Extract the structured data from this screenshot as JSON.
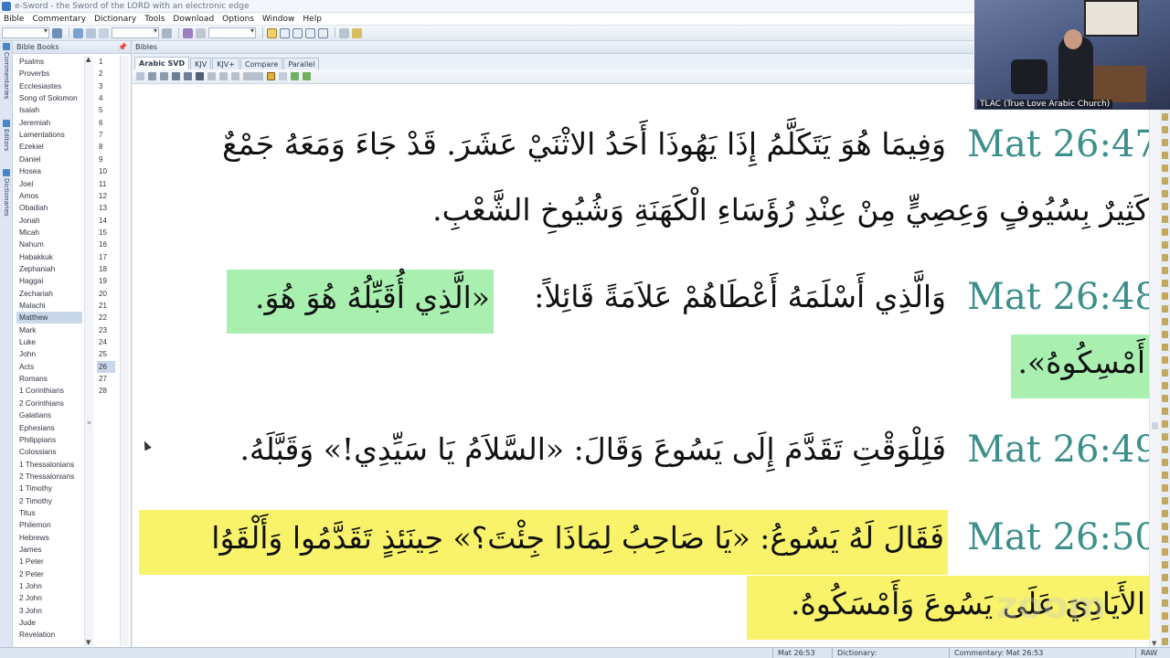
{
  "window": {
    "title": "e-Sword - the Sword of the LORD with an electronic edge"
  },
  "menu": [
    "Bible",
    "Commentary",
    "Dictionary",
    "Tools",
    "Download",
    "Options",
    "Window",
    "Help"
  ],
  "side_tabs": [
    "Commentaries",
    "Editors",
    "Dictionaries"
  ],
  "books_panel": {
    "title": "Bible Books",
    "pin": "📌",
    "books": [
      "Psalms",
      "Proverbs",
      "Ecclesiastes",
      "Song of Solomon",
      "Isaiah",
      "Jeremiah",
      "Lamentations",
      "Ezekiel",
      "Daniel",
      "Hosea",
      "Joel",
      "Amos",
      "Obadiah",
      "Jonah",
      "Micah",
      "Nahum",
      "Habakkuk",
      "Zephaniah",
      "Haggai",
      "Zechariah",
      "Malachi",
      "Matthew",
      "Mark",
      "Luke",
      "John",
      "Acts",
      "Romans",
      "1 Corinthians",
      "2 Corinthians",
      "Galatians",
      "Ephesians",
      "Philippians",
      "Colossians",
      "1 Thessalonians",
      "2 Thessalonians",
      "1 Timothy",
      "2 Timothy",
      "Titus",
      "Philemon",
      "Hebrews",
      "James",
      "1 Peter",
      "2 Peter",
      "1 John",
      "2 John",
      "3 John",
      "Jude",
      "Revelation"
    ],
    "selected_book": "Matthew",
    "chapters": [
      "1",
      "2",
      "3",
      "4",
      "5",
      "6",
      "7",
      "8",
      "9",
      "10",
      "11",
      "12",
      "13",
      "14",
      "15",
      "16",
      "17",
      "18",
      "19",
      "20",
      "21",
      "22",
      "23",
      "24",
      "25",
      "26",
      "27",
      "28"
    ],
    "selected_chapter": "26"
  },
  "bibles": {
    "title": "Bibles",
    "tabs": [
      "Arabic SVD",
      "KJV",
      "KJV+",
      "Compare",
      "Parallel"
    ],
    "active_tab": "Arabic SVD"
  },
  "verses": [
    {
      "ref": "Mat 26:47",
      "lines": [
        "وَفِيمَا هُوَ يَتَكَلَّمُ إِذَا يَهُوذَا أَحَدُ الاثْنَيْ عَشَرَ. قَدْ جَاءَ وَمَعَهُ جَمْعٌ",
        "كَثِيرٌ بِسُيُوفٍ وَعِصِيٍّ مِنْ عِنْدِ رُؤَسَاءِ الْكَهَنَةِ وَشُيُوخِ الشَّعْبِ."
      ]
    },
    {
      "ref": "Mat 26:48",
      "lines": [
        "وَالَّذِي أَسْلَمَهُ أَعْطَاهُمْ عَلاَمَةً قَائِلاً:",
        "«الَّذِي أُقَبِّلُهُ هُوَ هُوَ.",
        "أَمْسِكُوهُ»."
      ]
    },
    {
      "ref": "Mat 26:49",
      "lines": [
        "فَلِلْوَقْتِ تَقَدَّمَ إِلَى يَسُوعَ وَقَالَ: «السَّلاَمُ يَا سَيِّدِي!» وَقَبَّلَهُ."
      ]
    },
    {
      "ref": "Mat 26:50",
      "lines": [
        "فَقَالَ لَهُ يَسُوعُ: «يَا صَاحِبُ لِمَاذَا جِئْتَ؟» حِينَئِذٍ تَقَدَّمُوا وَأَلْقَوُا",
        "الأَيَادِيَ عَلَى يَسُوعَ وَأَمْسَكُوهُ."
      ]
    }
  ],
  "status": {
    "verse": "Mat 26:53",
    "dictionary": "Dictionary:",
    "commentary": "Commentary: Mat 26:53",
    "mode": "RAW"
  },
  "webcam": {
    "label": "TLAC (True Love Arabic Church)"
  },
  "watermark": "zoom",
  "colors": {
    "verse_ref": "#3c8f8b",
    "highlight_green": "#a8efb0",
    "highlight_yellow": "#f8f36a",
    "selection": "#c9d7ea"
  }
}
